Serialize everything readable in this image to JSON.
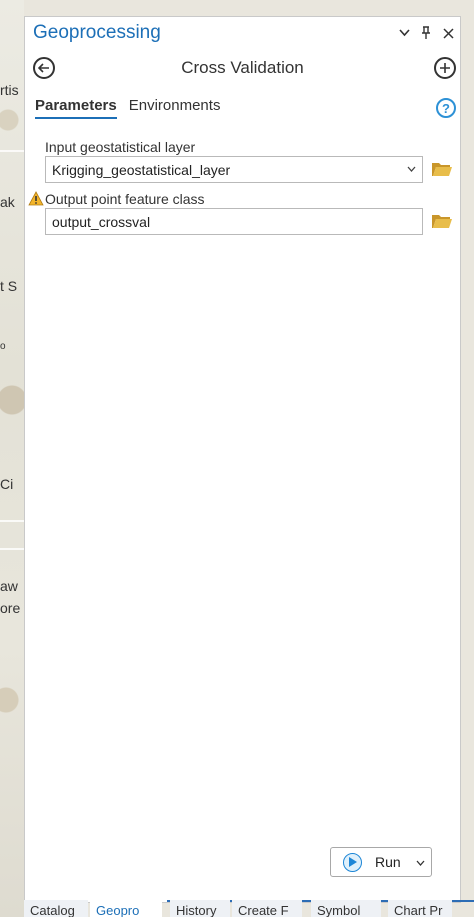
{
  "map": {
    "labels": [
      "rtis",
      "ak",
      "t S",
      "o",
      "Ci",
      "aw",
      "ore"
    ]
  },
  "pane": {
    "title": "Geoprocessing",
    "icons": [
      "chevron-down-icon",
      "pin-icon",
      "close-icon"
    ]
  },
  "tool": {
    "title": "Cross Validation"
  },
  "tabs": {
    "parameters": "Parameters",
    "environments": "Environments",
    "help_glyph": "?"
  },
  "params": {
    "input_label": "Input geostatistical layer",
    "input_value": "Krigging_geostatistical_layer",
    "output_label": "Output point feature class",
    "output_value": "output_crossval"
  },
  "run": {
    "label": "Run"
  },
  "bottom_tabs": [
    "Catalog",
    "Geopro",
    "History",
    "Create F",
    "Symbol",
    "Chart Pr"
  ],
  "colors": {
    "accent": "#1c6fb7",
    "folder": "#e0b33a",
    "warning": "#e8a21e"
  }
}
